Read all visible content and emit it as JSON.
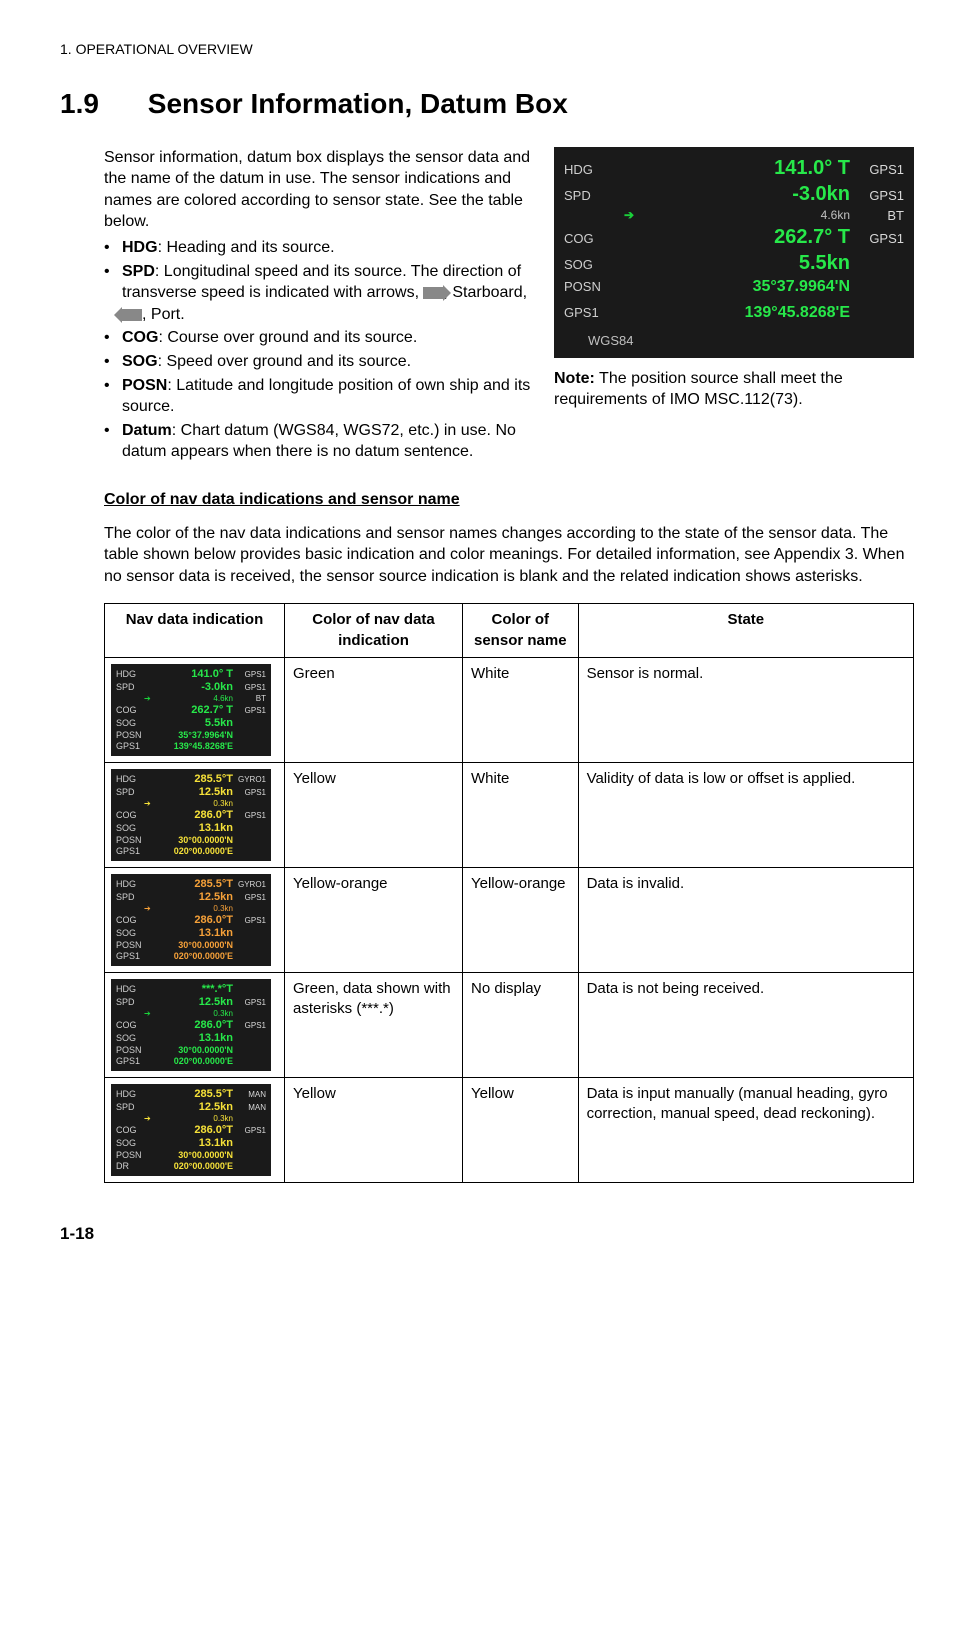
{
  "header": {
    "chapter": "1.  OPERATIONAL OVERVIEW",
    "section_no": "1.9",
    "section_title": "Sensor Information, Datum Box"
  },
  "intro": {
    "p1": "Sensor information, datum box displays the sensor data and the name of the datum in use. The sensor indications and names are colored according to sensor state. See the table below.",
    "items": {
      "hdg_b": "HDG",
      "hdg_t": ": Heading and its source.",
      "spd_b": "SPD",
      "spd_t1": ": Longitudinal speed and its source. The direction of transverse speed is indicated with arrows, ",
      "spd_t2": ", Starboard, ",
      "spd_t3": ", Port.",
      "cog_b": "COG",
      "cog_t": ": Course over ground and its source.",
      "sog_b": "SOG",
      "sog_t": ": Speed over ground and its source.",
      "posn_b": "POSN",
      "posn_t": ": Latitude and longitude position of own ship and its source.",
      "datum_b": "Datum",
      "datum_t": ": Chart datum (WGS84, WGS72, etc.) in use. No datum appears when there is no datum sentence."
    }
  },
  "main_figure": {
    "rows": {
      "hdg": {
        "lbl": "HDG",
        "val": "141.0° T",
        "src": "GPS1"
      },
      "spd": {
        "lbl": "SPD",
        "val": "-3.0kn",
        "src": "GPS1"
      },
      "aux": {
        "arrow": "➔",
        "val": "4.6kn",
        "src": "BT"
      },
      "cog": {
        "lbl": "COG",
        "val": "262.7° T",
        "src": "GPS1"
      },
      "sog": {
        "lbl": "SOG",
        "val": "5.5kn",
        "src": ""
      },
      "posn": {
        "lbl": "POSN",
        "val": "35°37.9964'N",
        "src": ""
      },
      "posn2": {
        "lbl": "GPS1",
        "val": "139°45.8268'E",
        "src": ""
      },
      "datum": "WGS84"
    }
  },
  "note": {
    "label": "Note:",
    "text": " The position source shall meet the requirements of IMO MSC.112(73)."
  },
  "subhead": "Color of nav data indications and sensor name",
  "body_p": "The color of the nav data indications and sensor names changes according to the state of the sensor data. The table shown below provides basic indication and color meanings. For detailed information, see Appendix 3. When no sensor data is received, the sensor source indication is blank and the related indication shows asterisks.",
  "table": {
    "headers": {
      "c1": "Nav data indication",
      "c2": "Color of nav data indication",
      "c3": "Color of sensor name",
      "c4": "State"
    },
    "rows": [
      {
        "nav_color": "Green",
        "sensor_color": "White",
        "state": "Sensor is normal.",
        "fig": {
          "val_cls": "green",
          "src_cls": "gray",
          "aux_cls": "",
          "hdg": {
            "val": "141.0° T",
            "src": "GPS1"
          },
          "spd": {
            "val": "-3.0kn",
            "src": "GPS1"
          },
          "aux": {
            "val": "4.6kn",
            "src": "BT"
          },
          "cog": {
            "val": "262.7° T",
            "src": "GPS1"
          },
          "sog": {
            "val": "5.5kn",
            "src": ""
          },
          "posn": {
            "lbl": "POSN",
            "val": "35°37.9964'N"
          },
          "posn2": {
            "lbl": "GPS1",
            "val": "139°45.8268'E"
          }
        }
      },
      {
        "nav_color": "Yellow",
        "sensor_color": "White",
        "state": "Validity of data is low or offset is applied.",
        "fig": {
          "val_cls": "yellow",
          "src_cls": "gray",
          "aux_cls": "yel",
          "hdg": {
            "val": "285.5°T",
            "src": "GYRO1"
          },
          "spd": {
            "val": "12.5kn",
            "src": "GPS1"
          },
          "aux": {
            "val": "0.3kn",
            "src": ""
          },
          "cog": {
            "val": "286.0°T",
            "src": "GPS1"
          },
          "sog": {
            "val": "13.1kn",
            "src": ""
          },
          "posn": {
            "lbl": "POSN",
            "val": "30°00.0000'N"
          },
          "posn2": {
            "lbl": "GPS1",
            "val": "020°00.0000'E"
          }
        }
      },
      {
        "nav_color": "Yellow-orange",
        "sensor_color": "Yellow-orange",
        "state": "Data is invalid.",
        "fig": {
          "val_cls": "orange",
          "src_cls": "orange",
          "aux_cls": "ora",
          "hdg": {
            "val": "285.5°T",
            "src": "GYRO1"
          },
          "spd": {
            "val": "12.5kn",
            "src": "GPS1"
          },
          "aux": {
            "val": "0.3kn",
            "src": ""
          },
          "cog": {
            "val": "286.0°T",
            "src": "GPS1"
          },
          "sog": {
            "val": "13.1kn",
            "src": ""
          },
          "posn": {
            "lbl": "POSN",
            "val": "30°00.0000'N"
          },
          "posn2": {
            "lbl": "GPS1",
            "val": "020°00.0000'E"
          }
        }
      },
      {
        "nav_color": "Green, data shown with asterisks (***.*)",
        "sensor_color": "No display",
        "state": "Data is not being received.",
        "fig": {
          "val_cls": "green",
          "src_cls": "gray",
          "aux_cls": "",
          "hdg": {
            "val": "***.*°T",
            "src": ""
          },
          "spd": {
            "val": "12.5kn",
            "src": "GPS1"
          },
          "aux": {
            "val": "0.3kn",
            "src": ""
          },
          "cog": {
            "val": "286.0°T",
            "src": "GPS1"
          },
          "sog": {
            "val": "13.1kn",
            "src": ""
          },
          "posn": {
            "lbl": "POSN",
            "val": "30°00.0000'N"
          },
          "posn2": {
            "lbl": "GPS1",
            "val": "020°00.0000'E"
          }
        }
      },
      {
        "nav_color": "Yellow",
        "sensor_color": "Yellow",
        "state": "Data is input manually (manual heading, gyro correction, manual speed, dead reckoning).",
        "fig": {
          "val_cls": "yellow",
          "src_cls": "yellow",
          "aux_cls": "yel",
          "hdg": {
            "val": "285.5°T",
            "src": "MAN"
          },
          "spd": {
            "val": "12.5kn",
            "src": "MAN"
          },
          "aux": {
            "val": "0.3kn",
            "src": ""
          },
          "cog": {
            "val": "286.0°T",
            "src": "GPS1"
          },
          "sog": {
            "val": "13.1kn",
            "src": ""
          },
          "posn": {
            "lbl": "POSN",
            "val": "30°00.0000'N"
          },
          "posn2": {
            "lbl": "DR",
            "val": "020°00.0000'E"
          }
        }
      }
    ]
  },
  "footer": {
    "page": "1-18"
  }
}
